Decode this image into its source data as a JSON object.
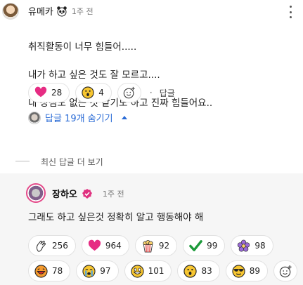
{
  "comment": {
    "author": "유메카",
    "time": "1주 전",
    "lines": [
      "취직활동이 너무 힘들어.....",
      "내가 하고 싶은 것도 잘 모르고....",
      "내 장점도 없는 것 같기도 하고 진짜 힘들어요.."
    ],
    "reactions": [
      {
        "icon": "heart-icon",
        "count": "28"
      },
      {
        "icon": "surprised-face-icon",
        "count": "4"
      }
    ],
    "dot": "·",
    "reply_label": "답글"
  },
  "replies_toggle": {
    "label": "답글 19개 숨기기"
  },
  "more_newest": {
    "label": "최신 답글 더 보기"
  },
  "reply": {
    "author": "장하오",
    "time": "1주 전",
    "text": "그래도 하고 싶은것 정확히 알고 행동해야 해",
    "reactions_row1": [
      {
        "icon": "clap-icon",
        "count": "256"
      },
      {
        "icon": "heart-icon",
        "count": "964"
      },
      {
        "icon": "popcorn-icon",
        "count": "92"
      },
      {
        "icon": "checkmark-icon",
        "count": "99"
      },
      {
        "icon": "flower-icon",
        "count": "98"
      }
    ],
    "reactions_row2": [
      {
        "icon": "laughing-face-icon",
        "count": "78"
      },
      {
        "icon": "crying-face-icon",
        "count": "97"
      },
      {
        "icon": "grinning-face-icon",
        "count": "101"
      },
      {
        "icon": "surprised-face-icon",
        "count": "83"
      },
      {
        "icon": "sunglasses-face-icon",
        "count": "89"
      }
    ]
  },
  "colors": {
    "link": "#2a6bd6",
    "heart": "#e62c83",
    "reply_bg": "#f6f6f6"
  }
}
